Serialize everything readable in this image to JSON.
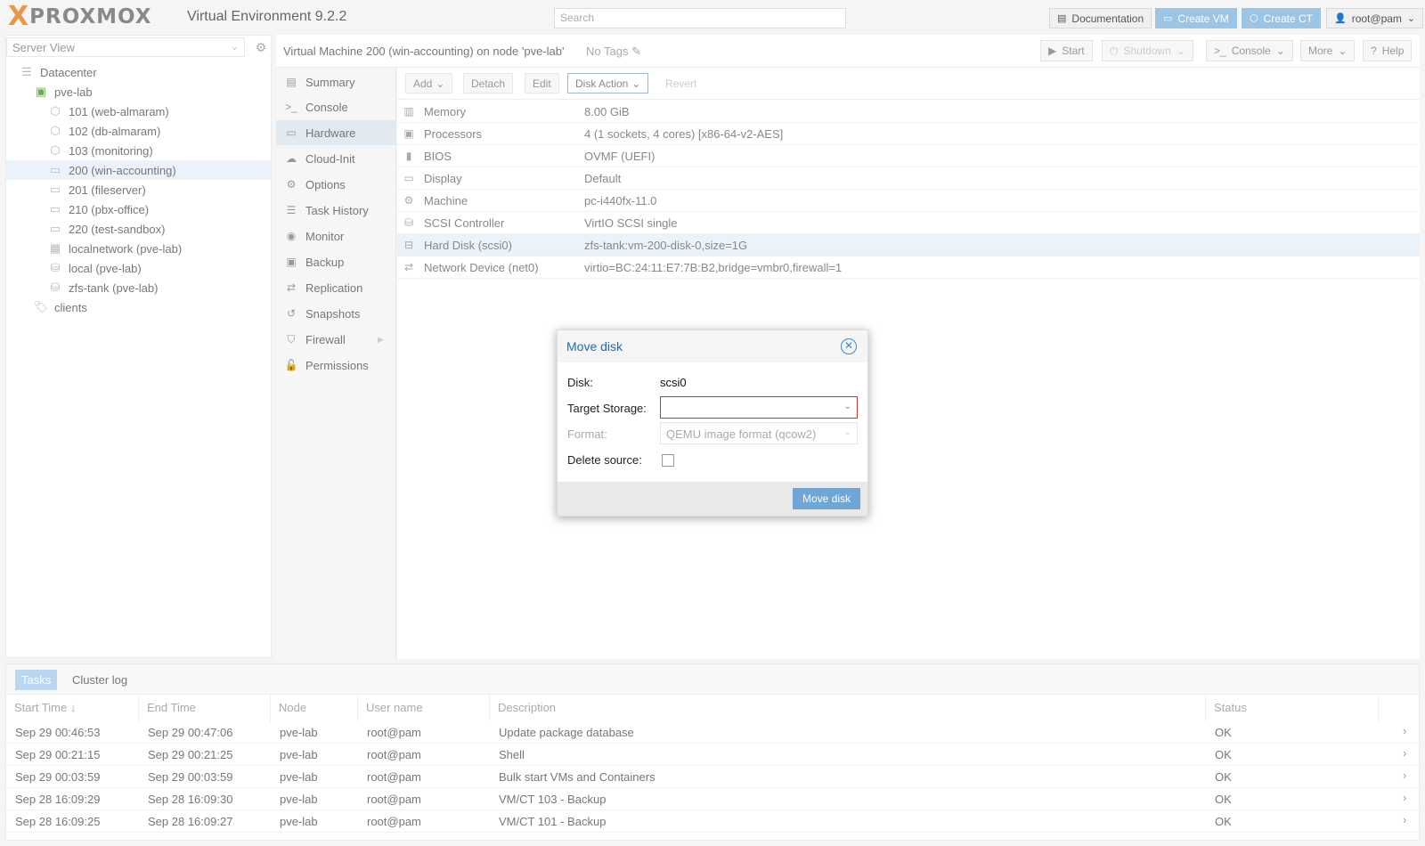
{
  "topbar": {
    "logo_x": "X",
    "logo_text": "PROXMOX",
    "version": "Virtual Environment 9.2.2",
    "search_placeholder": "Search",
    "documentation": "Documentation",
    "create_vm": "Create VM",
    "create_ct": "Create CT",
    "user": "root@pam"
  },
  "tree": {
    "view": "Server View",
    "items": [
      {
        "label": "Datacenter"
      },
      {
        "label": "pve-lab"
      },
      {
        "label": "101 (web-almaram)"
      },
      {
        "label": "102 (db-almaram)"
      },
      {
        "label": "103 (monitoring)"
      },
      {
        "label": "200 (win-accounting)"
      },
      {
        "label": "201 (fileserver)"
      },
      {
        "label": "210 (pbx-office)"
      },
      {
        "label": "220 (test-sandbox)"
      },
      {
        "label": "localnetwork (pve-lab)"
      },
      {
        "label": "local (pve-lab)"
      },
      {
        "label": "zfs-tank (pve-lab)"
      },
      {
        "label": "clients"
      }
    ]
  },
  "header": {
    "title": "Virtual Machine 200 (win-accounting) on node 'pve-lab'",
    "tags": "No Tags",
    "start": "Start",
    "shutdown": "Shutdown",
    "console": "Console",
    "more": "More",
    "help": "Help"
  },
  "nav": {
    "items": [
      {
        "label": "Summary"
      },
      {
        "label": "Console"
      },
      {
        "label": "Hardware"
      },
      {
        "label": "Cloud-Init"
      },
      {
        "label": "Options"
      },
      {
        "label": "Task History"
      },
      {
        "label": "Monitor"
      },
      {
        "label": "Backup"
      },
      {
        "label": "Replication"
      },
      {
        "label": "Snapshots"
      },
      {
        "label": "Firewall"
      },
      {
        "label": "Permissions"
      }
    ]
  },
  "hardware": {
    "toolbar": {
      "add": "Add",
      "detach": "Detach",
      "edit": "Edit",
      "disk_action": "Disk Action",
      "revert": "Revert"
    },
    "rows": [
      {
        "name": "Memory",
        "value": "8.00 GiB"
      },
      {
        "name": "Processors",
        "value": "4 (1 sockets, 4 cores) [x86-64-v2-AES]"
      },
      {
        "name": "BIOS",
        "value": "OVMF (UEFI)"
      },
      {
        "name": "Display",
        "value": "Default"
      },
      {
        "name": "Machine",
        "value": "pc-i440fx-11.0"
      },
      {
        "name": "SCSI Controller",
        "value": "VirtIO SCSI single"
      },
      {
        "name": "Hard Disk (scsi0)",
        "value": "zfs-tank:vm-200-disk-0,size=1G"
      },
      {
        "name": "Network Device (net0)",
        "value": "virtio=BC:24:11:E7:7B:B2,bridge=vmbr0,firewall=1"
      }
    ]
  },
  "modal": {
    "title": "Move disk",
    "disk_label": "Disk:",
    "disk_value": "scsi0",
    "target_label": "Target Storage:",
    "target_value": "",
    "format_label": "Format:",
    "format_value": "QEMU image format (qcow2)",
    "delete_label": "Delete source:",
    "delete_checked": false,
    "submit": "Move disk"
  },
  "tasks": {
    "tabs": [
      "Tasks",
      "Cluster log"
    ],
    "columns": [
      "Start Time",
      "End Time",
      "Node",
      "User name",
      "Description",
      "Status"
    ],
    "rows": [
      {
        "start": "Sep 29 00:46:53",
        "end": "Sep 29 00:47:06",
        "node": "pve-lab",
        "user": "root@pam",
        "desc": "Update package database",
        "status": "OK"
      },
      {
        "start": "Sep 29 00:21:15",
        "end": "Sep 29 00:21:25",
        "node": "pve-lab",
        "user": "root@pam",
        "desc": "Shell",
        "status": "OK"
      },
      {
        "start": "Sep 29 00:03:59",
        "end": "Sep 29 00:03:59",
        "node": "pve-lab",
        "user": "root@pam",
        "desc": "Bulk start VMs and Containers",
        "status": "OK"
      },
      {
        "start": "Sep 28 16:09:29",
        "end": "Sep 28 16:09:30",
        "node": "pve-lab",
        "user": "root@pam",
        "desc": "VM/CT 103 - Backup",
        "status": "OK"
      },
      {
        "start": "Sep 28 16:09:25",
        "end": "Sep 28 16:09:27",
        "node": "pve-lab",
        "user": "root@pam",
        "desc": "VM/CT 101 - Backup",
        "status": "OK"
      }
    ]
  },
  "colors": {
    "accent": "#1a6fb5",
    "selection": "#ebf2f9",
    "logo_orange": "#e57000",
    "error_border": "#cc3333"
  }
}
